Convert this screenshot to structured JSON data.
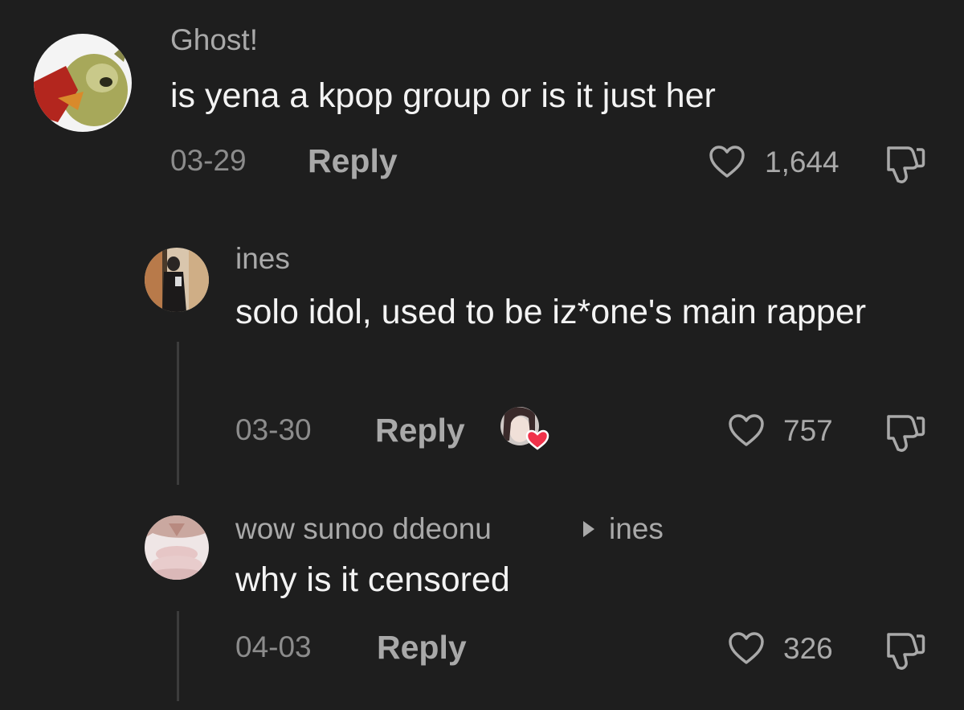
{
  "comments": [
    {
      "username": "Ghost!",
      "text": "is yena a kpop group or is it just her",
      "date": "03-29",
      "reply_label": "Reply",
      "likes": "1,644",
      "avatar_icon": "angry-bird-avatar"
    },
    {
      "username": "ines",
      "text": "solo idol, used to be iz*one's main rapper",
      "date": "03-30",
      "reply_label": "Reply",
      "likes": "757",
      "avatar_icon": "person-avatar",
      "liked_by_creator_icon": "creator-heart-avatar"
    },
    {
      "username": "wow sunoo ddeonu",
      "reply_to": "ines",
      "text": "why is it censored",
      "date": "04-03",
      "reply_label": "Reply",
      "likes": "326",
      "avatar_icon": "anime-avatar"
    }
  ],
  "colors": {
    "background": "#1e1e1e",
    "username": "#a9a9a9",
    "text": "#f3f3f3",
    "muted": "#8c8c8c"
  }
}
